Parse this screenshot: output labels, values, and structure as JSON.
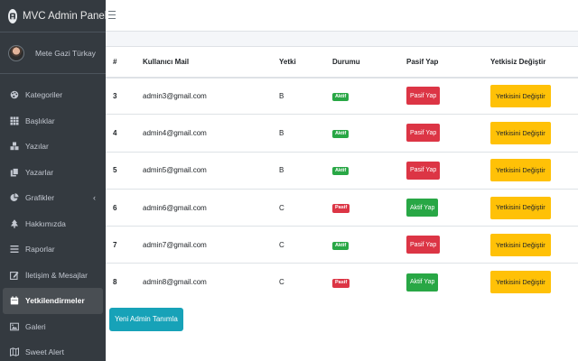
{
  "brand": {
    "title": "MVC Admin Paneli",
    "logo_icon": "logo-icon"
  },
  "user": {
    "name": "Mete Gazi Türkay"
  },
  "sidebar": {
    "items": [
      {
        "label": "Kategoriler",
        "icon": "palette-icon",
        "active": false
      },
      {
        "label": "Başlıklar",
        "icon": "grid-icon",
        "active": false
      },
      {
        "label": "Yazılar",
        "icon": "cubes-icon",
        "active": false
      },
      {
        "label": "Yazarlar",
        "icon": "copy-icon",
        "active": false
      },
      {
        "label": "Grafikler",
        "icon": "pie-chart-icon",
        "active": false,
        "caret": "‹"
      },
      {
        "label": "Hakkımızda",
        "icon": "tree-icon",
        "active": false
      },
      {
        "label": "Raporlar",
        "icon": "list-icon",
        "active": false
      },
      {
        "label": "İletişim & Mesajlar",
        "icon": "edit-icon",
        "active": false
      },
      {
        "label": "Yetkilendirmeler",
        "icon": "calendar-icon",
        "active": true
      },
      {
        "label": "Galeri",
        "icon": "image-icon",
        "active": false
      },
      {
        "label": "Sweet Alert",
        "icon": "map-icon",
        "active": false
      }
    ]
  },
  "table": {
    "headers": {
      "id": "#",
      "mail": "Kullanıcı Mail",
      "role": "Yetki",
      "status": "Durumu",
      "toggle": "Pasif Yap",
      "change": "Yetkisiz Değiştir"
    },
    "rows": [
      {
        "id": "3",
        "mail": "admin3@gmail.com",
        "role": "B",
        "status": "Aktif",
        "status_color": "#28a745",
        "toggle": "Pasif Yap",
        "toggle_color": "#dc3545",
        "change": "Yetkisini Değiştir"
      },
      {
        "id": "4",
        "mail": "admin4@gmail.com",
        "role": "B",
        "status": "Aktif",
        "status_color": "#28a745",
        "toggle": "Pasif Yap",
        "toggle_color": "#dc3545",
        "change": "Yetkisini Değiştir"
      },
      {
        "id": "5",
        "mail": "admin5@gmail.com",
        "role": "B",
        "status": "Aktif",
        "status_color": "#28a745",
        "toggle": "Pasif Yap",
        "toggle_color": "#dc3545",
        "change": "Yetkisini Değiştir"
      },
      {
        "id": "6",
        "mail": "admin6@gmail.com",
        "role": "C",
        "status": "Pasif",
        "status_color": "#dc3545",
        "toggle": "Aktif Yap",
        "toggle_color": "#28a745",
        "change": "Yetkisini Değiştir"
      },
      {
        "id": "7",
        "mail": "admin7@gmail.com",
        "role": "C",
        "status": "Aktif",
        "status_color": "#28a745",
        "toggle": "Pasif Yap",
        "toggle_color": "#dc3545",
        "change": "Yetkisini Değiştir"
      },
      {
        "id": "8",
        "mail": "admin8@gmail.com",
        "role": "C",
        "status": "Pasif",
        "status_color": "#dc3545",
        "toggle": "Aktif Yap",
        "toggle_color": "#28a745",
        "change": "Yetkisini Değiştir"
      }
    ]
  },
  "actions": {
    "add_admin": "Yeni Admin Tanımla"
  },
  "colors": {
    "sidebar_bg": "#343a40",
    "success": "#28a745",
    "danger": "#dc3545",
    "warning": "#ffc107",
    "info": "#17a2b8"
  }
}
